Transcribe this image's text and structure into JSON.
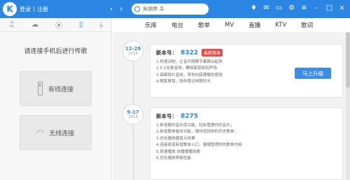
{
  "topbar": {
    "logo_letter": "K",
    "login_label": "登录",
    "separator": "|",
    "register_label": "注册",
    "back_glyph": "‹",
    "forward_glyph": "›",
    "search_value": "朱婉婷 寻",
    "icons": [
      "shirt-icon",
      "mail-icon",
      "message-icon",
      "gear-icon",
      "menu-icon",
      "minimize-icon",
      "maximize-icon",
      "close-icon"
    ]
  },
  "left": {
    "tabs": [
      {
        "icon": "music-note-icon",
        "glyph": "♫"
      },
      {
        "icon": "cloud-icon",
        "glyph": "☁"
      },
      {
        "icon": "radio-icon",
        "glyph": "⦿"
      },
      {
        "icon": "phone-icon",
        "glyph": "▯"
      },
      {
        "icon": "download-icon",
        "glyph": "⤓"
      }
    ],
    "hint": "请连接手机后进行传歌",
    "wired_label": "有线连接",
    "wireless_label": "无线连接"
  },
  "main": {
    "tabs": [
      "乐库",
      "电台",
      "歌单",
      "MV",
      "直播",
      "KTV",
      "歌词"
    ],
    "releases": [
      {
        "date": "12-28",
        "year": "2016",
        "version_label": "新本号：",
        "version": "8322",
        "badge": "最新版本",
        "notes": [
          "1.桥遇动物，让音乐随眼节奏跳动起来",
          "2.5.1全景音效，模拟家庭影院声场",
          "3.高解锁片音效，带你抗踩理解的感觉",
          "4.随笑屏保，陪你度过闲聊时光"
        ],
        "upgrade_label": "马上升级"
      },
      {
        "date": "9-17",
        "year": "2016",
        "version_label": "新本号：",
        "version": "8275",
        "notes": [
          "1.新增歌的音乐库功能，轻松管理你的音乐；",
          "2.新增歌单备份功能，随时找回你的历史歌单；",
          "3.优化播放器显示效果",
          "4.连接频道新增歌单入口，便捷管理你的歌单内容",
          "5.很速播放 快播播播放歌",
          "6.优化播放界面性能"
        ]
      }
    ]
  }
}
